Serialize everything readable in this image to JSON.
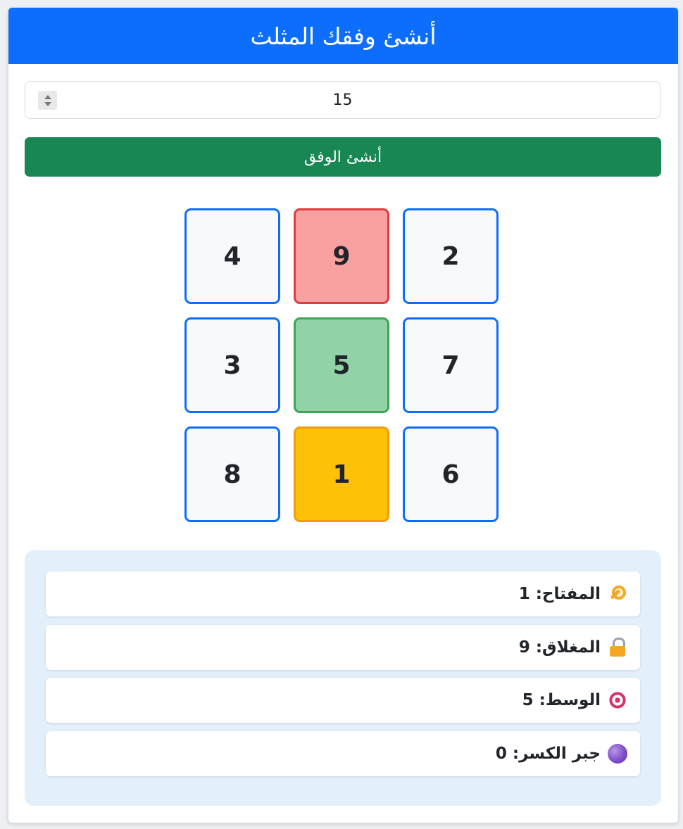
{
  "header": {
    "title": "أنشئ وفقك المثلث"
  },
  "input": {
    "value": "15"
  },
  "generate_button": {
    "label": "أنشئ الوفق"
  },
  "grid": {
    "cells": [
      {
        "value": "4",
        "style": "normal"
      },
      {
        "value": "9",
        "style": "lock"
      },
      {
        "value": "2",
        "style": "normal"
      },
      {
        "value": "3",
        "style": "normal"
      },
      {
        "value": "5",
        "style": "mid"
      },
      {
        "value": "7",
        "style": "normal"
      },
      {
        "value": "8",
        "style": "normal"
      },
      {
        "value": "1",
        "style": "key"
      },
      {
        "value": "6",
        "style": "normal"
      }
    ]
  },
  "info": {
    "rows": [
      {
        "icon": "key-icon",
        "label": "المفتاح:",
        "value": "1"
      },
      {
        "icon": "lock-icon",
        "label": "المغلاق:",
        "value": "9"
      },
      {
        "icon": "target-icon",
        "label": "الوسط:",
        "value": "5"
      },
      {
        "icon": "purple-circle-icon",
        "label": "جبر الكسر:",
        "value": "0"
      }
    ]
  },
  "colors": {
    "header": "#0d6efd",
    "button": "#198754",
    "lock_cell": "#f9a0a0",
    "mid_cell": "#91d3a6",
    "key_cell": "#ffc107",
    "info_panel": "#e3f0fc"
  }
}
